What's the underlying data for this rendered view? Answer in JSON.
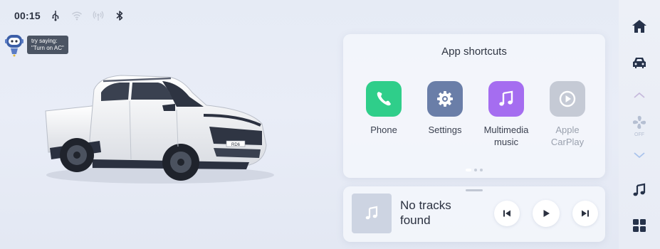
{
  "status_bar": {
    "time": "00:15",
    "icons": [
      "usb-icon",
      "wifi-icon",
      "hotspot-icon",
      "bluetooth-icon"
    ]
  },
  "assistant": {
    "hint_line1": "try saying:",
    "hint_line2": "\"Turn on AC\""
  },
  "car": {
    "plate_text": "RD6",
    "body_color": "#f2f3f5"
  },
  "shortcuts": {
    "title": "App shortcuts",
    "apps": [
      {
        "label": "Phone",
        "icon": "phone-icon",
        "color": "#2fce8a",
        "enabled": true
      },
      {
        "label": "Settings",
        "icon": "settings-icon",
        "color": "#6a7ea8",
        "enabled": true
      },
      {
        "label": "Multimedia\nmusic",
        "icon": "music-icon",
        "color": "#a56df0",
        "enabled": true
      },
      {
        "label": "Apple\nCarPlay",
        "icon": "carplay-icon",
        "color": "#c5cad5",
        "enabled": false
      }
    ],
    "page_count": 3,
    "current_page": 1
  },
  "media": {
    "title": "No tracks found",
    "controls": [
      "previous-track-icon",
      "play-icon",
      "next-track-icon"
    ]
  },
  "dock": {
    "items": [
      "home-icon",
      "vehicle-icon",
      "chevron-up-icon",
      "fan-icon",
      "chevron-down-icon",
      "music-note-icon",
      "apps-grid-icon"
    ],
    "fan_status": "OFF",
    "accent": "#26324a",
    "muted": "#b5bfd2"
  },
  "colors": {
    "background": "#e7ebf5",
    "panel": "#f3f5fb",
    "text": "#2b3140"
  }
}
